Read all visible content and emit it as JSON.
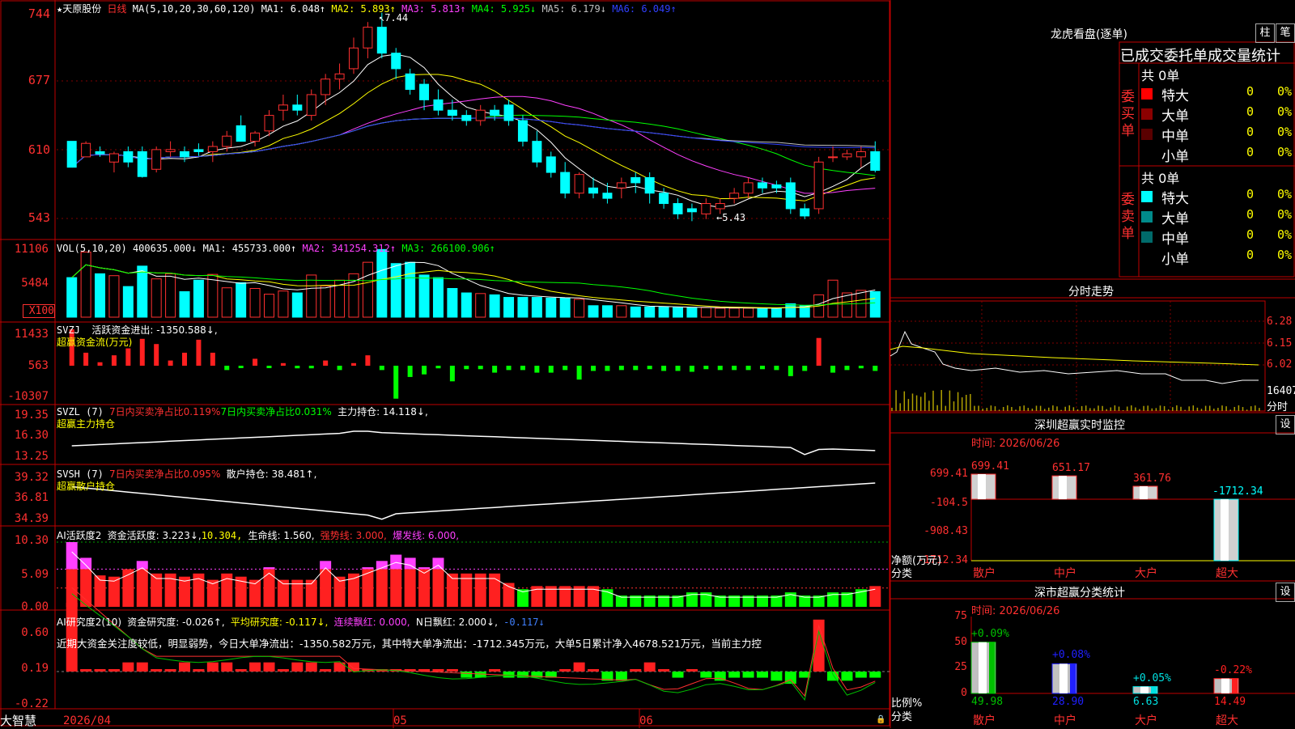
{
  "stock": {
    "name": "天原股份",
    "period": "日线",
    "star": "★"
  },
  "main": {
    "ma_label": "MA(5,10,20,30,60,120)",
    "ma": [
      {
        "name": "MA1",
        "value": "6.048↑",
        "color": "#ffffff"
      },
      {
        "name": "MA2",
        "value": "5.893↑",
        "color": "#ffff00"
      },
      {
        "name": "MA3",
        "value": "5.813↑",
        "color": "#ff40ff"
      },
      {
        "name": "MA4",
        "value": "5.925↓",
        "color": "#00ff00"
      },
      {
        "name": "MA5",
        "value": "6.179↓",
        "color": "#c0c0c0"
      },
      {
        "name": "MA6",
        "value": "6.049↑",
        "color": "#3040ff"
      }
    ],
    "yticks": [
      "744",
      "677",
      "610",
      "543"
    ],
    "high_mark": "7.44",
    "low_mark": "←5.43",
    "candles": [
      [
        6.2,
        6.2,
        5.95,
        5.95
      ],
      [
        6.05,
        6.2,
        6.05,
        6.18
      ],
      [
        6.1,
        6.15,
        6.05,
        6.08
      ],
      [
        6.0,
        6.1,
        5.9,
        6.08
      ],
      [
        6.1,
        6.15,
        5.95,
        6.0
      ],
      [
        6.1,
        6.15,
        5.85,
        5.86
      ],
      [
        5.93,
        6.15,
        5.9,
        6.12
      ],
      [
        6.1,
        6.2,
        6.05,
        6.12
      ],
      [
        6.1,
        6.15,
        6.0,
        6.05
      ],
      [
        6.12,
        6.18,
        6.06,
        6.1
      ],
      [
        6.1,
        6.2,
        6.0,
        6.15
      ],
      [
        6.15,
        6.3,
        6.1,
        6.25
      ],
      [
        6.35,
        6.45,
        6.2,
        6.2
      ],
      [
        6.2,
        6.3,
        6.15,
        6.28
      ],
      [
        6.3,
        6.5,
        6.25,
        6.45
      ],
      [
        6.5,
        6.65,
        6.4,
        6.55
      ],
      [
        6.55,
        6.65,
        6.45,
        6.5
      ],
      [
        6.45,
        6.7,
        6.4,
        6.65
      ],
      [
        6.65,
        6.85,
        6.55,
        6.8
      ],
      [
        6.8,
        6.95,
        6.7,
        6.85
      ],
      [
        6.9,
        7.2,
        6.85,
        7.1
      ],
      [
        7.1,
        7.35,
        7.0,
        7.3
      ],
      [
        7.3,
        7.44,
        7.0,
        7.05
      ],
      [
        7.05,
        7.1,
        6.8,
        6.9
      ],
      [
        6.85,
        6.9,
        6.65,
        6.7
      ],
      [
        6.75,
        6.8,
        6.5,
        6.6
      ],
      [
        6.6,
        6.7,
        6.45,
        6.5
      ],
      [
        6.5,
        6.6,
        6.4,
        6.45
      ],
      [
        6.45,
        6.5,
        6.35,
        6.4
      ],
      [
        6.4,
        6.55,
        6.35,
        6.5
      ],
      [
        6.5,
        6.55,
        6.4,
        6.45
      ],
      [
        6.55,
        6.6,
        6.35,
        6.4
      ],
      [
        6.4,
        6.45,
        6.15,
        6.2
      ],
      [
        6.2,
        6.3,
        5.95,
        6.0
      ],
      [
        6.05,
        6.1,
        5.85,
        5.9
      ],
      [
        5.9,
        6.0,
        5.65,
        5.7
      ],
      [
        5.7,
        5.9,
        5.65,
        5.88
      ],
      [
        5.75,
        5.85,
        5.65,
        5.7
      ],
      [
        5.7,
        5.8,
        5.6,
        5.65
      ],
      [
        5.75,
        5.85,
        5.65,
        5.8
      ],
      [
        5.85,
        5.9,
        5.7,
        5.8
      ],
      [
        5.85,
        5.9,
        5.6,
        5.7
      ],
      [
        5.7,
        5.75,
        5.55,
        5.6
      ],
      [
        5.6,
        5.65,
        5.45,
        5.5
      ],
      [
        5.55,
        5.6,
        5.43,
        5.52
      ],
      [
        5.5,
        5.65,
        5.45,
        5.6
      ],
      [
        5.55,
        5.65,
        5.5,
        5.6
      ],
      [
        5.65,
        5.75,
        5.6,
        5.7
      ],
      [
        5.7,
        5.85,
        5.65,
        5.8
      ],
      [
        5.8,
        5.85,
        5.7,
        5.75
      ],
      [
        5.78,
        5.82,
        5.7,
        5.75
      ],
      [
        5.8,
        5.85,
        5.5,
        5.55
      ],
      [
        5.55,
        5.6,
        5.45,
        5.48
      ],
      [
        5.55,
        6.05,
        5.5,
        6.0
      ],
      [
        6.05,
        6.15,
        6.0,
        6.05
      ],
      [
        6.05,
        6.12,
        6.02,
        6.08
      ],
      [
        6.05,
        6.15,
        5.95,
        6.1
      ],
      [
        6.1,
        6.2,
        5.9,
        5.92
      ]
    ]
  },
  "vol": {
    "label": "VOL(5,10,20)",
    "value": "400635.000↓",
    "ma1": "MA1: 455733.000↑",
    "ma2": "MA2: 341254.312↑",
    "ma3": "MA3: 266100.906↑",
    "yticks": [
      "11106",
      "5484"
    ],
    "unit": "X100",
    "values": [
      6200,
      10200,
      6800,
      6500,
      4800,
      8000,
      6000,
      6800,
      4000,
      5800,
      6700,
      4600,
      5400,
      4500,
      3600,
      4100,
      3800,
      6600,
      4900,
      5800,
      6800,
      8600,
      10600,
      8400,
      8600,
      6600,
      6200,
      4500,
      3800,
      3700,
      3500,
      3100,
      3100,
      3100,
      3000,
      3000,
      2800,
      1800,
      1800,
      1800,
      1600,
      1600,
      1600,
      1500,
      1500,
      1500,
      1400,
      1400,
      1400,
      1400,
      1400,
      2100,
      1800,
      3500,
      5800,
      3800,
      4200,
      4000
    ]
  },
  "svzj": {
    "label": "SVZJ",
    "title": "活跃资金进出: -1350.588↓,",
    "sub": "超赢资金流(万元)",
    "yticks": [
      "11433",
      "563",
      "-10307"
    ],
    "values": [
      4200,
      1500,
      400,
      1200,
      2000,
      3100,
      2500,
      600,
      1500,
      3000,
      1500,
      -500,
      -200,
      800,
      -200,
      300,
      -300,
      -300,
      600,
      -500,
      300,
      1200,
      -500,
      -3800,
      -1300,
      -1000,
      -300,
      -1800,
      -400,
      -400,
      -800,
      -500,
      -500,
      -800,
      -800,
      -500,
      -1600,
      -600,
      -600,
      -500,
      -500,
      -400,
      -600,
      -600,
      -700,
      -400,
      -500,
      -500,
      -500,
      -400,
      -500,
      -1200,
      -600,
      3200,
      -800,
      -500,
      -300,
      -600
    ]
  },
  "svzl": {
    "label": "SVZL (7)",
    "p1": "7日内买卖净占比0.119%",
    "p2": "7日内买卖净占比0.031%",
    "p3": "主力持仓: 14.118↓,",
    "sub": "超赢主力持仓",
    "yticks": [
      "19.35",
      "16.30",
      "13.25"
    ]
  },
  "svsh": {
    "label": "SVSH (7)",
    "p1": "7日内买卖净占比0.095%",
    "p2": "散户持仓: 38.481↑,",
    "sub": "超赢散户持仓",
    "yticks": [
      "39.32",
      "36.81",
      "34.39"
    ]
  },
  "ai1": {
    "label": "AI活跃度2",
    "p1": "资金活跃度: 3.223↓,",
    "p2": "10.304,",
    "p3": "生命线: 1.560,",
    "p4": "强势线: 3.000,",
    "p5": "爆发线: 6.000,",
    "yticks": [
      "10.30",
      "5.09",
      "0.00"
    ],
    "values": [
      10.3,
      7.8,
      5.0,
      4.8,
      6.0,
      7.3,
      5.3,
      5.3,
      4.8,
      5.3,
      4.3,
      5.3,
      4.8,
      4.3,
      6.3,
      4.3,
      4.3,
      4.3,
      7.3,
      4.8,
      5.3,
      6.3,
      7.3,
      8.3,
      7.8,
      6.3,
      7.8,
      5.3,
      5.3,
      5.3,
      5.3,
      3.8,
      2.8,
      3.3,
      3.3,
      3.3,
      3.3,
      3.3,
      2.8,
      1.8,
      1.8,
      1.8,
      1.8,
      1.8,
      2.3,
      2.3,
      1.8,
      1.8,
      1.8,
      1.8,
      1.8,
      2.3,
      1.8,
      1.8,
      2.3,
      2.3,
      2.8,
      3.3
    ]
  },
  "ai2": {
    "label": "AI研究度2(10)",
    "p1": "资金研究度: -0.026↑,",
    "p2": "平均研究度: -0.117↓,",
    "p3": "连续飘红: 0.000,",
    "p4": "N日飘红: 2.000↓,",
    "p5": "-0.117↓",
    "yticks": [
      "0.60",
      "0.19",
      "-0.22"
    ],
    "text": "近期大资金关注度较低，明显弱势，今日大单净流出：-1350.582万元，其中特大单净流出：-1712.345万元，大单5日累计净入4678.521万元，当前主力控",
    "values": [
      0.45,
      0.0,
      0.0,
      0.0,
      0.06,
      0.06,
      0.0,
      0.0,
      0.06,
      0.0,
      0.06,
      0.06,
      0.0,
      0.06,
      0.06,
      0.0,
      0.06,
      0.06,
      0.0,
      0.06,
      0.06,
      0.0,
      0.0,
      0.0,
      0.0,
      0.0,
      0.0,
      0.0,
      -0.04,
      -0.04,
      0.0,
      -0.04,
      -0.04,
      -0.04,
      -0.04,
      0.0,
      0.06,
      0.0,
      -0.06,
      -0.06,
      0.0,
      0.06,
      0.0,
      -0.04,
      0.0,
      -0.04,
      -0.06,
      -0.04,
      -0.04,
      -0.04,
      -0.06,
      -0.08,
      -0.04,
      0.34,
      -0.06,
      -0.06,
      -0.04,
      -0.04
    ]
  },
  "xaxis": {
    "d1": "2026/04",
    "d2": "05",
    "d3": "06"
  },
  "brand": "大智慧",
  "lhb": {
    "title": "龙虎看盘(逐单)",
    "btn1": "柱",
    "btn2": "笔",
    "head": "已成交委托单成交量统计",
    "buy": {
      "side": "委买单",
      "total": "共 0单",
      "rows": [
        {
          "n": "特大",
          "v": "0",
          "p": "0%",
          "c": "#ff0000"
        },
        {
          "n": "大单",
          "v": "0",
          "p": "0%",
          "c": "#8b0000"
        },
        {
          "n": "中单",
          "v": "0",
          "p": "0%",
          "c": "#5a0000"
        },
        {
          "n": "小单",
          "v": "0",
          "p": "0%",
          "c": "#000000"
        }
      ]
    },
    "sell": {
      "side": "委卖单",
      "total": "共 0单",
      "rows": [
        {
          "n": "特大",
          "v": "0",
          "p": "0%",
          "c": "#00ffff"
        },
        {
          "n": "大单",
          "v": "0",
          "p": "0%",
          "c": "#008b8b"
        },
        {
          "n": "中单",
          "v": "0",
          "p": "0%",
          "c": "#006b6b"
        },
        {
          "n": "小单",
          "v": "0",
          "p": "0%",
          "c": "#000000"
        }
      ]
    }
  },
  "fs": {
    "title": "分时走势",
    "yticks": [
      "6.28",
      "6.15",
      "6.02"
    ],
    "vol": "16407",
    "unit": "分时"
  },
  "sz": {
    "title": "深圳超赢实时监控",
    "btn": "设",
    "time": "时间: 2026/06/26",
    "yticks": [
      "699.41",
      "-104.5",
      "-908.43",
      "-1712.34"
    ],
    "ylabel": "净额(万元)",
    "xlabel": "分类",
    "bars": [
      {
        "cat": "散户",
        "v": 699.41,
        "label": "699.41"
      },
      {
        "cat": "中户",
        "v": 651.17,
        "label": "651.17"
      },
      {
        "cat": "大户",
        "v": 361.76,
        "label": "361.76"
      },
      {
        "cat": "超大",
        "v": -1712.34,
        "label": "-1712.34"
      }
    ]
  },
  "fl": {
    "title": "深市超赢分类统计",
    "btn": "设",
    "time": "时间: 2026/06/26",
    "yticks": [
      "75",
      "50",
      "25",
      "0"
    ],
    "ylabel": "比例%",
    "xlabel": "分类",
    "bars": [
      {
        "cat": "散户",
        "v": 49.98,
        "label": "49.98",
        "chg": "+0.09%",
        "c": "#00c000"
      },
      {
        "cat": "中户",
        "v": 28.9,
        "label": "28.90",
        "chg": "+0.08%",
        "c": "#2020ff"
      },
      {
        "cat": "大户",
        "v": 6.63,
        "label": "6.63",
        "chg": "+0.05%",
        "c": "#00e0e0"
      },
      {
        "cat": "超大",
        "v": 14.49,
        "label": "14.49",
        "chg": "-0.22%",
        "c": "#ff2020"
      }
    ]
  }
}
